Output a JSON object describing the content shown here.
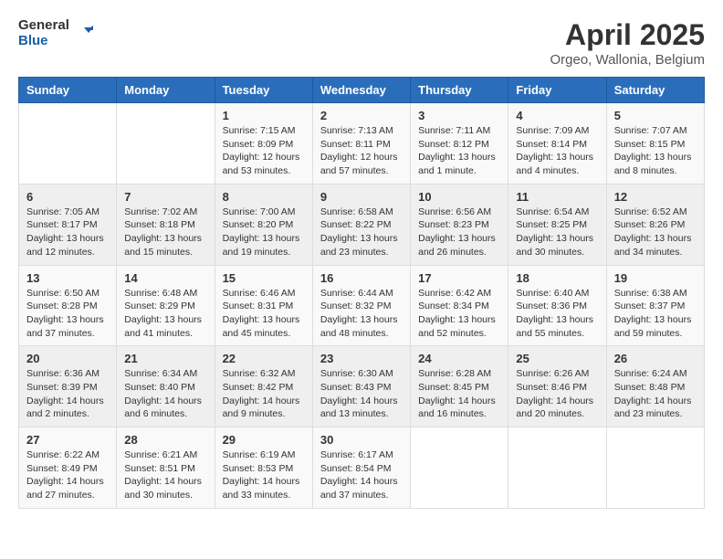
{
  "logo": {
    "general": "General",
    "blue": "Blue"
  },
  "title": "April 2025",
  "subtitle": "Orgeo, Wallonia, Belgium",
  "days_header": [
    "Sunday",
    "Monday",
    "Tuesday",
    "Wednesday",
    "Thursday",
    "Friday",
    "Saturday"
  ],
  "weeks": [
    [
      {
        "day": "",
        "info": ""
      },
      {
        "day": "",
        "info": ""
      },
      {
        "day": "1",
        "info": "Sunrise: 7:15 AM\nSunset: 8:09 PM\nDaylight: 12 hours and 53 minutes."
      },
      {
        "day": "2",
        "info": "Sunrise: 7:13 AM\nSunset: 8:11 PM\nDaylight: 12 hours and 57 minutes."
      },
      {
        "day": "3",
        "info": "Sunrise: 7:11 AM\nSunset: 8:12 PM\nDaylight: 13 hours and 1 minute."
      },
      {
        "day": "4",
        "info": "Sunrise: 7:09 AM\nSunset: 8:14 PM\nDaylight: 13 hours and 4 minutes."
      },
      {
        "day": "5",
        "info": "Sunrise: 7:07 AM\nSunset: 8:15 PM\nDaylight: 13 hours and 8 minutes."
      }
    ],
    [
      {
        "day": "6",
        "info": "Sunrise: 7:05 AM\nSunset: 8:17 PM\nDaylight: 13 hours and 12 minutes."
      },
      {
        "day": "7",
        "info": "Sunrise: 7:02 AM\nSunset: 8:18 PM\nDaylight: 13 hours and 15 minutes."
      },
      {
        "day": "8",
        "info": "Sunrise: 7:00 AM\nSunset: 8:20 PM\nDaylight: 13 hours and 19 minutes."
      },
      {
        "day": "9",
        "info": "Sunrise: 6:58 AM\nSunset: 8:22 PM\nDaylight: 13 hours and 23 minutes."
      },
      {
        "day": "10",
        "info": "Sunrise: 6:56 AM\nSunset: 8:23 PM\nDaylight: 13 hours and 26 minutes."
      },
      {
        "day": "11",
        "info": "Sunrise: 6:54 AM\nSunset: 8:25 PM\nDaylight: 13 hours and 30 minutes."
      },
      {
        "day": "12",
        "info": "Sunrise: 6:52 AM\nSunset: 8:26 PM\nDaylight: 13 hours and 34 minutes."
      }
    ],
    [
      {
        "day": "13",
        "info": "Sunrise: 6:50 AM\nSunset: 8:28 PM\nDaylight: 13 hours and 37 minutes."
      },
      {
        "day": "14",
        "info": "Sunrise: 6:48 AM\nSunset: 8:29 PM\nDaylight: 13 hours and 41 minutes."
      },
      {
        "day": "15",
        "info": "Sunrise: 6:46 AM\nSunset: 8:31 PM\nDaylight: 13 hours and 45 minutes."
      },
      {
        "day": "16",
        "info": "Sunrise: 6:44 AM\nSunset: 8:32 PM\nDaylight: 13 hours and 48 minutes."
      },
      {
        "day": "17",
        "info": "Sunrise: 6:42 AM\nSunset: 8:34 PM\nDaylight: 13 hours and 52 minutes."
      },
      {
        "day": "18",
        "info": "Sunrise: 6:40 AM\nSunset: 8:36 PM\nDaylight: 13 hours and 55 minutes."
      },
      {
        "day": "19",
        "info": "Sunrise: 6:38 AM\nSunset: 8:37 PM\nDaylight: 13 hours and 59 minutes."
      }
    ],
    [
      {
        "day": "20",
        "info": "Sunrise: 6:36 AM\nSunset: 8:39 PM\nDaylight: 14 hours and 2 minutes."
      },
      {
        "day": "21",
        "info": "Sunrise: 6:34 AM\nSunset: 8:40 PM\nDaylight: 14 hours and 6 minutes."
      },
      {
        "day": "22",
        "info": "Sunrise: 6:32 AM\nSunset: 8:42 PM\nDaylight: 14 hours and 9 minutes."
      },
      {
        "day": "23",
        "info": "Sunrise: 6:30 AM\nSunset: 8:43 PM\nDaylight: 14 hours and 13 minutes."
      },
      {
        "day": "24",
        "info": "Sunrise: 6:28 AM\nSunset: 8:45 PM\nDaylight: 14 hours and 16 minutes."
      },
      {
        "day": "25",
        "info": "Sunrise: 6:26 AM\nSunset: 8:46 PM\nDaylight: 14 hours and 20 minutes."
      },
      {
        "day": "26",
        "info": "Sunrise: 6:24 AM\nSunset: 8:48 PM\nDaylight: 14 hours and 23 minutes."
      }
    ],
    [
      {
        "day": "27",
        "info": "Sunrise: 6:22 AM\nSunset: 8:49 PM\nDaylight: 14 hours and 27 minutes."
      },
      {
        "day": "28",
        "info": "Sunrise: 6:21 AM\nSunset: 8:51 PM\nDaylight: 14 hours and 30 minutes."
      },
      {
        "day": "29",
        "info": "Sunrise: 6:19 AM\nSunset: 8:53 PM\nDaylight: 14 hours and 33 minutes."
      },
      {
        "day": "30",
        "info": "Sunrise: 6:17 AM\nSunset: 8:54 PM\nDaylight: 14 hours and 37 minutes."
      },
      {
        "day": "",
        "info": ""
      },
      {
        "day": "",
        "info": ""
      },
      {
        "day": "",
        "info": ""
      }
    ]
  ]
}
